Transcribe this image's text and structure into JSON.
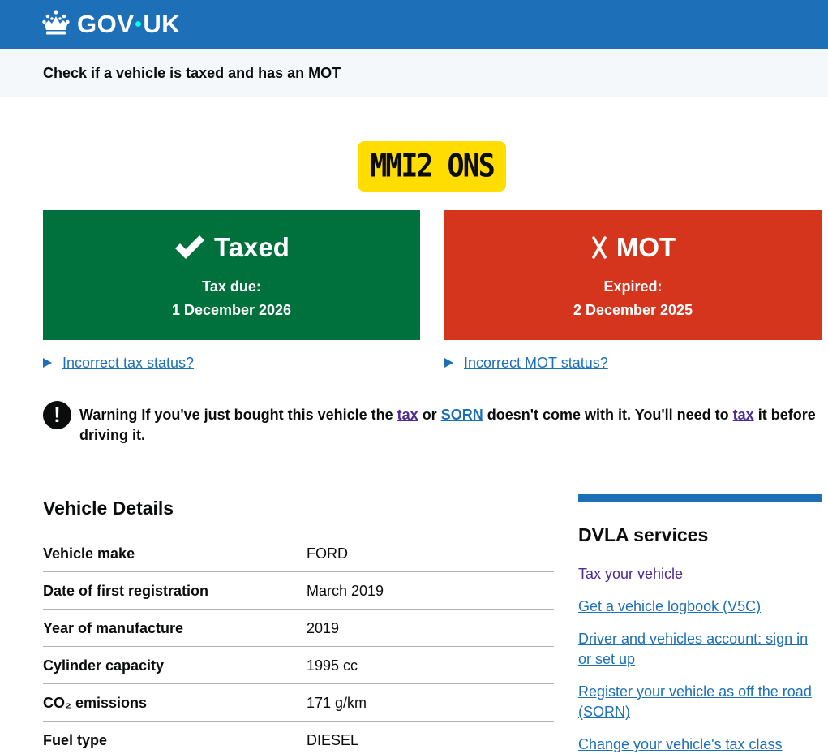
{
  "header": {
    "logo_text_left": "GOV",
    "logo_text_right": "UK",
    "service_name": "Check if a vehicle is taxed and has an MOT"
  },
  "registration_plate": "MMI2 ONS",
  "tax_status": {
    "title": "Taxed",
    "label": "Tax due:",
    "date": "1 December 2026",
    "color": "#00703c",
    "icon": "check-icon",
    "details_link": "Incorrect tax status?"
  },
  "mot_status": {
    "title": "MOT",
    "label": "Expired:",
    "date": "2 December 2025",
    "color": "#d4351c",
    "icon": "cross-icon",
    "details_link": "Incorrect MOT status?"
  },
  "warning": {
    "icon": "!",
    "part1": "Warning If you've just bought this vehicle the",
    "link_tax": "tax",
    "part2": "or",
    "link_sorn": "SORN",
    "part3": "doesn't come with it. You'll need to",
    "link_tax2": "tax",
    "part4": "it before driving it."
  },
  "vehicle_details": {
    "heading": "Vehicle Details",
    "rows": [
      {
        "label": "Vehicle make",
        "value": "FORD"
      },
      {
        "label": "Date of first registration",
        "value": "March 2019"
      },
      {
        "label": "Year of manufacture",
        "value": "2019"
      },
      {
        "label": "Cylinder capacity",
        "value": "1995 cc"
      },
      {
        "label": "CO₂ emissions",
        "value": "171 g/km"
      },
      {
        "label": "Fuel type",
        "value": "DIESEL"
      }
    ]
  },
  "dvla_services": {
    "heading": "DVLA services",
    "links": [
      "Tax your vehicle",
      "Get a vehicle logbook (V5C)",
      "Driver and vehicles account: sign in or set up",
      "Register your vehicle as off the road (SORN)",
      "Change your vehicle's tax class"
    ]
  },
  "colors": {
    "header_blue": "#1d70b8",
    "plate_yellow": "#ffdd00",
    "link_blue": "#1d70b8",
    "visited_purple": "#4c2c92"
  }
}
